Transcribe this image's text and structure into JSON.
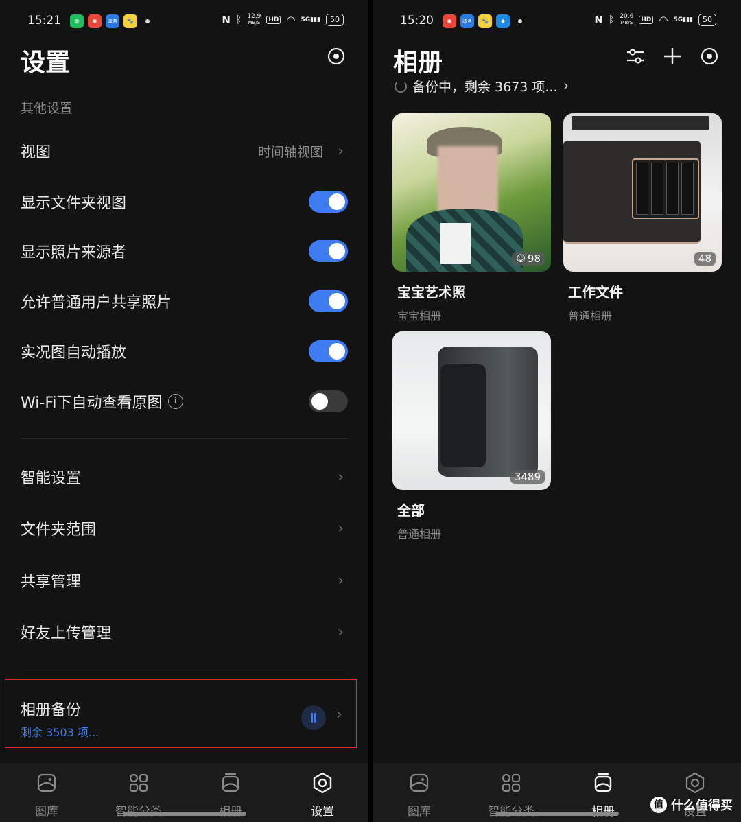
{
  "left": {
    "status": {
      "time": "15:21",
      "apps": [
        {
          "icon": "wechat-icon",
          "color": "#1fbf5f",
          "text": "◍"
        },
        {
          "icon": "weibo-icon",
          "color": "#e8473a",
          "text": "◉"
        },
        {
          "icon": "app-icon",
          "color": "#2c7be5",
          "text": "政务"
        },
        {
          "icon": "app-icon",
          "color": "#f4d03f",
          "text": "🐾"
        }
      ],
      "speed_top": "12.9",
      "speed_unit": "MB/S",
      "hd": "HD",
      "net": "5G",
      "battery": "50"
    },
    "title": "设置",
    "section": "其他设置",
    "rows": [
      {
        "label": "视图",
        "value": "时间轴视图"
      },
      {
        "label": "显示文件夹视图"
      },
      {
        "label": "显示照片来源者"
      },
      {
        "label": "允许普通用户共享照片"
      },
      {
        "label": "实况图自动播放"
      },
      {
        "label": "Wi-Fi下自动查看原图"
      },
      {
        "label": "智能设置"
      },
      {
        "label": "文件夹范围"
      },
      {
        "label": "共享管理"
      },
      {
        "label": "好友上传管理"
      }
    ],
    "backup": {
      "title": "相册备份",
      "sub": "剩余 3503 项..."
    },
    "nav": [
      "图库",
      "智能分类",
      "相册",
      "设置"
    ]
  },
  "right": {
    "status": {
      "time": "15:20",
      "apps": [
        {
          "icon": "weibo-icon",
          "color": "#e8473a",
          "text": "◉"
        },
        {
          "icon": "app-icon",
          "color": "#2c7be5",
          "text": "政务"
        },
        {
          "icon": "app-icon",
          "color": "#f4d03f",
          "text": "🐾"
        },
        {
          "icon": "app-icon",
          "color": "#1e88e5",
          "text": "◆"
        }
      ],
      "speed_top": "20.6",
      "speed_unit": "MB/S",
      "hd": "HD",
      "net": "5G",
      "battery": "50"
    },
    "title": "相册",
    "backup_status": "备份中，剩余 3673 项...",
    "albums": [
      {
        "name": "宝宝艺术照",
        "type": "宝宝相册",
        "count": "98"
      },
      {
        "name": "工作文件",
        "type": "普通相册",
        "count": "48"
      },
      {
        "name": "全部",
        "type": "普通相册",
        "count": "3489"
      }
    ],
    "nav": [
      "图库",
      "智能分类",
      "相册",
      "设置"
    ],
    "watermark": "什么值得买",
    "watermark_logo": "值"
  },
  "colors": {
    "accent": "#3f7bf1",
    "highlight_box": "#d0342c",
    "background": "#131313"
  }
}
